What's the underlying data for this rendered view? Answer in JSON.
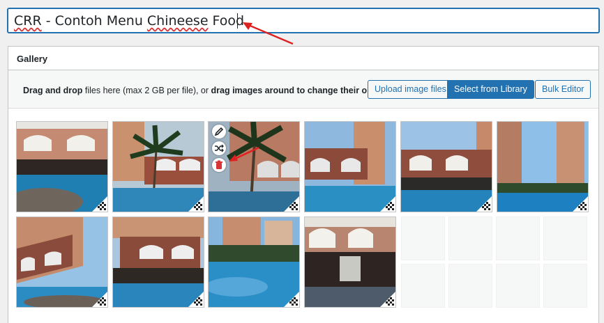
{
  "post": {
    "title_prefix": "CRR",
    "title_middle": " - Contoh Menu ",
    "title_misspelled": "Chineese",
    "title_suffix": " Food"
  },
  "gallery": {
    "heading": "Gallery",
    "hint_bold_1": "Drag and drop",
    "hint_text_1": " files here (max 2 GB per file), or ",
    "hint_bold_2": "drag images around to change their order",
    "upload_label": "Upload image files",
    "select_label": "Select from Library",
    "bulk_label": "Bulk Editor",
    "images": [
      {
        "name": "pool-arches"
      },
      {
        "name": "palm-pool"
      },
      {
        "name": "palm-building"
      },
      {
        "name": "tower-pool"
      },
      {
        "name": "arched-bridge"
      },
      {
        "name": "towers-sky"
      },
      {
        "name": "building-left"
      },
      {
        "name": "arched-deck"
      },
      {
        "name": "wide-pool"
      },
      {
        "name": "fountain-hall"
      }
    ],
    "tools": [
      "pencil-icon",
      "shuffle-icon",
      "trash-icon"
    ]
  },
  "colors": {
    "accent": "#2271b1",
    "annotation": "#e02020",
    "delete": "#d63638"
  }
}
